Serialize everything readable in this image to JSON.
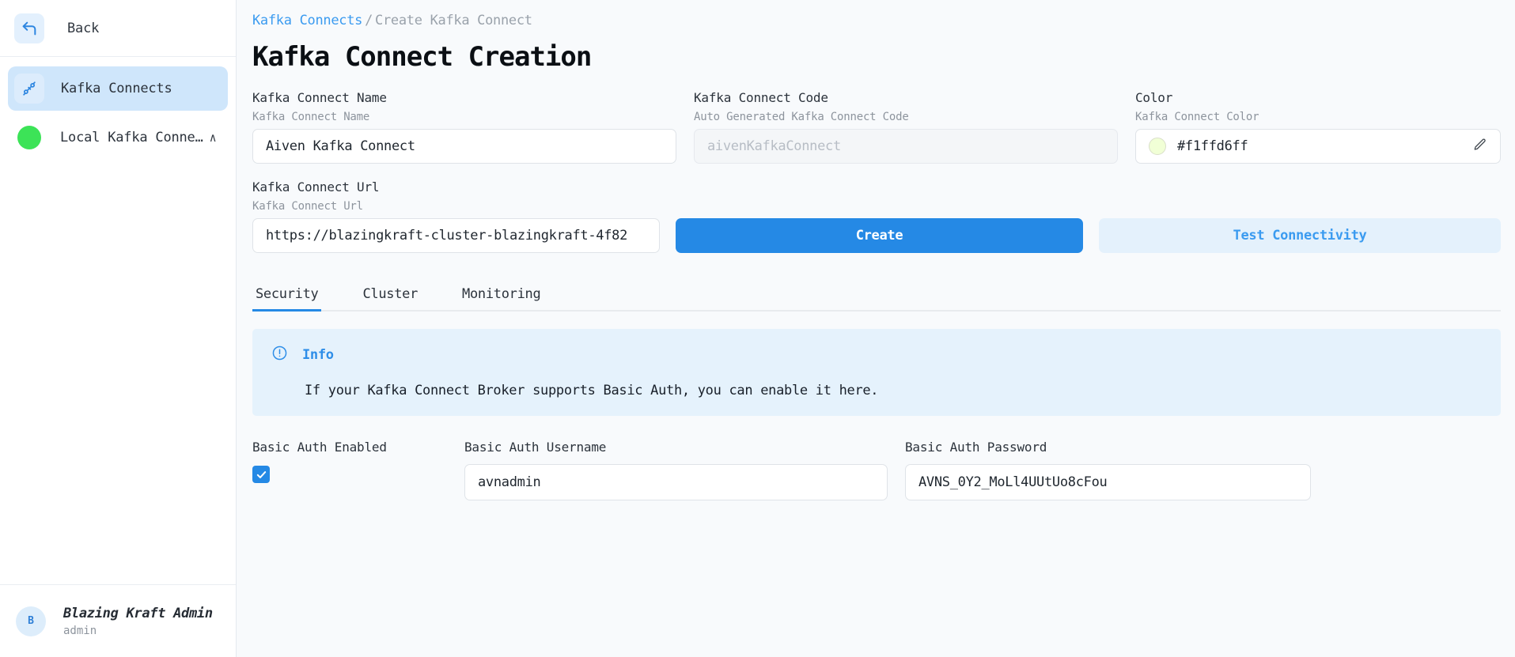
{
  "sidebar": {
    "back": {
      "label": "Back",
      "icon": "back-arrow-icon"
    },
    "nav_items": [
      {
        "label": "Kafka Connects",
        "icon": "kafka-connect-icon",
        "active": true
      }
    ],
    "cluster": {
      "label": "Local Kafka Conne…",
      "status_color": "#3ce357",
      "chevron": "∧"
    },
    "user": {
      "initial": "B",
      "name": "Blazing Kraft Admin",
      "role": "admin"
    }
  },
  "breadcrumb": {
    "link": "Kafka Connects",
    "separator": "/",
    "current": "Create Kafka Connect"
  },
  "page": {
    "title": "Kafka Connect Creation"
  },
  "form": {
    "name": {
      "label": "Kafka Connect Name",
      "sublabel": "Kafka Connect Name",
      "value": "Aiven Kafka Connect",
      "placeholder": "Kafka Connect Name"
    },
    "code": {
      "label": "Kafka Connect Code",
      "sublabel": "Auto Generated Kafka Connect Code",
      "value": "aivenKafkaConnect",
      "placeholder": "aivenKafkaConnect",
      "disabled": true
    },
    "color": {
      "label": "Color",
      "sublabel": "Kafka Connect Color",
      "value": "#f1ffd6ff",
      "swatch_hex": "#f1ffd6",
      "edit_icon": "pencil-icon"
    },
    "url": {
      "label": "Kafka Connect Url",
      "sublabel": "Kafka Connect Url",
      "value": "https://blazingkraft-cluster-blazingkraft-4f82",
      "placeholder": "Kafka Connect Url"
    }
  },
  "actions": {
    "create_label": "Create",
    "test_label": "Test Connectivity",
    "primary_color": "#2589e5"
  },
  "tabs": [
    {
      "label": "Security",
      "active": true
    },
    {
      "label": "Cluster",
      "active": false
    },
    {
      "label": "Monitoring",
      "active": false
    }
  ],
  "info": {
    "icon": "info-circle-icon",
    "title": "Info",
    "message": "If your Kafka Connect Broker supports Basic Auth, you can enable it here.",
    "accent_color": "#2e8ee8",
    "background": "#e5f2fc"
  },
  "basic_auth": {
    "enabled_label": "Basic Auth Enabled",
    "enabled": true,
    "username_label": "Basic Auth Username",
    "username_value": "avnadmin",
    "password_label": "Basic Auth Password",
    "password_value": "AVNS_0Y2_MoLl4UUtUo8cFou"
  }
}
